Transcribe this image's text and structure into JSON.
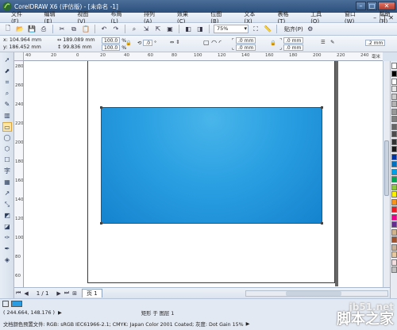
{
  "window": {
    "title": "CorelDRAW X6 (评估版) - [未命名 -1]",
    "min": "–",
    "max": "□",
    "close": "✕"
  },
  "menu": [
    "文件(F)",
    "编辑(E)",
    "视图(V)",
    "布局(L)",
    "排列(A)",
    "效果(C)",
    "位图(B)",
    "文本(X)",
    "表格(T)",
    "工具(O)",
    "窗口(W)",
    "帮助(H)"
  ],
  "menu_right": {
    "min": "–",
    "restore": "❐",
    "close": "✕"
  },
  "toolbar": {
    "zoom": "75%",
    "snap": "贴齐(P)"
  },
  "props": {
    "x": "x: 104.964 mm",
    "y": "y: 186.452 mm",
    "w": "189.089 mm",
    "h": "99.836 mm",
    "sx": "100.0",
    "sy": "100.0",
    "pct": "%",
    "rot": ".0",
    "deg": "°",
    "c1": ".0 mm",
    "c2": ".0 mm",
    "c3": ".0 mm",
    "c4": ".0 mm",
    "outline": ".2 mm"
  },
  "rulers": {
    "h": [
      "40",
      "20",
      "0",
      "20",
      "40",
      "60",
      "80",
      "100",
      "120",
      "140",
      "160",
      "180",
      "200",
      "220",
      "240"
    ],
    "h_unit": "毫米",
    "v": [
      "280",
      "260",
      "240",
      "220",
      "200",
      "180",
      "160",
      "140",
      "120",
      "100",
      "80",
      "60"
    ]
  },
  "pages": {
    "count": "1 / 1",
    "tab": "页 1"
  },
  "status": {
    "coords": "( 244.664, 148.176 )",
    "object": "矩形 于 图层 1",
    "color_profile": "文档颜色预置文件: RGB: sRGB IEC61966-2.1; CMYK: Japan Color 2001 Coated; 灰度: Dot Gain 15%",
    "arrow": "▶"
  },
  "watermark": {
    "url": "jb51.net",
    "cn": "脚本之家"
  },
  "colors": {
    "rect_fill": "#2aa0e2",
    "palette": [
      "#ffffff",
      "#000000",
      "#ffffff",
      "#e6e6e6",
      "#cccccc",
      "#b3b3b3",
      "#999999",
      "#808080",
      "#666666",
      "#4d4d4d",
      "#333333",
      "#1a1a1a",
      "#0033a0",
      "#0070c0",
      "#00a0e9",
      "#00a651",
      "#8dc63f",
      "#fff200",
      "#f7941d",
      "#ed1c24",
      "#ec008c",
      "#662d91",
      "#d2b48c",
      "#a0522d",
      "#c7b299",
      "#e6c8a0",
      "#f2dede",
      "#c0c0c0"
    ]
  }
}
